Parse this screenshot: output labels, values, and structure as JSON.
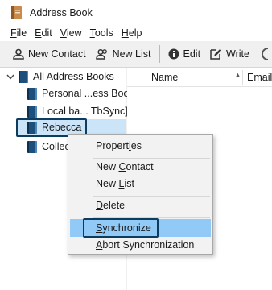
{
  "window": {
    "title": "Address Book"
  },
  "menubar": [
    {
      "label": "File",
      "key": "F",
      "rest": "ile"
    },
    {
      "label": "Edit",
      "key": "E",
      "rest": "dit"
    },
    {
      "label": "View",
      "key": "V",
      "rest": "iew"
    },
    {
      "label": "Tools",
      "key": "T",
      "rest": "ools"
    },
    {
      "label": "Help",
      "key": "H",
      "rest": "elp"
    }
  ],
  "toolbar": {
    "new_contact": "New Contact",
    "new_list": "New List",
    "edit": "Edit",
    "write": "Write"
  },
  "tree": {
    "root": "All Address Books",
    "items": [
      {
        "label": "Personal ...ess Book"
      },
      {
        "label": "Local ba... TbSync]"
      },
      {
        "label": "Rebecca"
      },
      {
        "label": "Collec"
      }
    ]
  },
  "list": {
    "columns": {
      "name": "Name",
      "email": "Email"
    }
  },
  "context_menu": {
    "items": [
      {
        "label": "Properties",
        "pre": "Propert",
        "key": "i",
        "post": "es"
      },
      {
        "label": "New Contact",
        "pre": "New ",
        "key": "C",
        "post": "ontact"
      },
      {
        "label": "New List",
        "pre": "New ",
        "key": "L",
        "post": "ist"
      },
      {
        "label": "Delete",
        "pre": "",
        "key": "D",
        "post": "elete"
      },
      {
        "label": "Synchronize",
        "pre": "",
        "key": "S",
        "post": "ynchronize"
      },
      {
        "label": "Abort Synchronization",
        "pre": "",
        "key": "A",
        "post": "bort Synchronization"
      }
    ]
  },
  "colors": {
    "selection": "#cce4f7",
    "menu_hover": "#91c9f7",
    "highlight_border": "#0d3d5e",
    "book_icon": "#1d4f7c"
  }
}
